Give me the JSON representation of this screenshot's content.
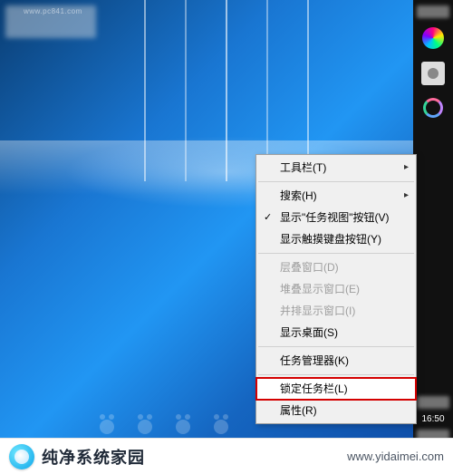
{
  "topleft_hint": "www.pc841.com",
  "context_menu": {
    "items": [
      {
        "label": "工具栏(T)",
        "arrow": true
      },
      {
        "sep": true
      },
      {
        "label": "搜索(H)",
        "arrow": true
      },
      {
        "label": "显示\"任务视图\"按钮(V)",
        "checked": true
      },
      {
        "label": "显示触摸键盘按钮(Y)"
      },
      {
        "sep": true
      },
      {
        "label": "层叠窗口(D)",
        "disabled": true
      },
      {
        "label": "堆叠显示窗口(E)",
        "disabled": true
      },
      {
        "label": "并排显示窗口(I)",
        "disabled": true
      },
      {
        "label": "显示桌面(S)"
      },
      {
        "sep": true
      },
      {
        "label": "任务管理器(K)"
      },
      {
        "sep": true
      },
      {
        "label": "锁定任务栏(L)",
        "highlighted": true
      },
      {
        "label": "属性(R)"
      }
    ]
  },
  "taskbar": {
    "time": "16:50"
  },
  "footer": {
    "title": "纯净系统家园",
    "url": "www.yidaimei.com"
  }
}
